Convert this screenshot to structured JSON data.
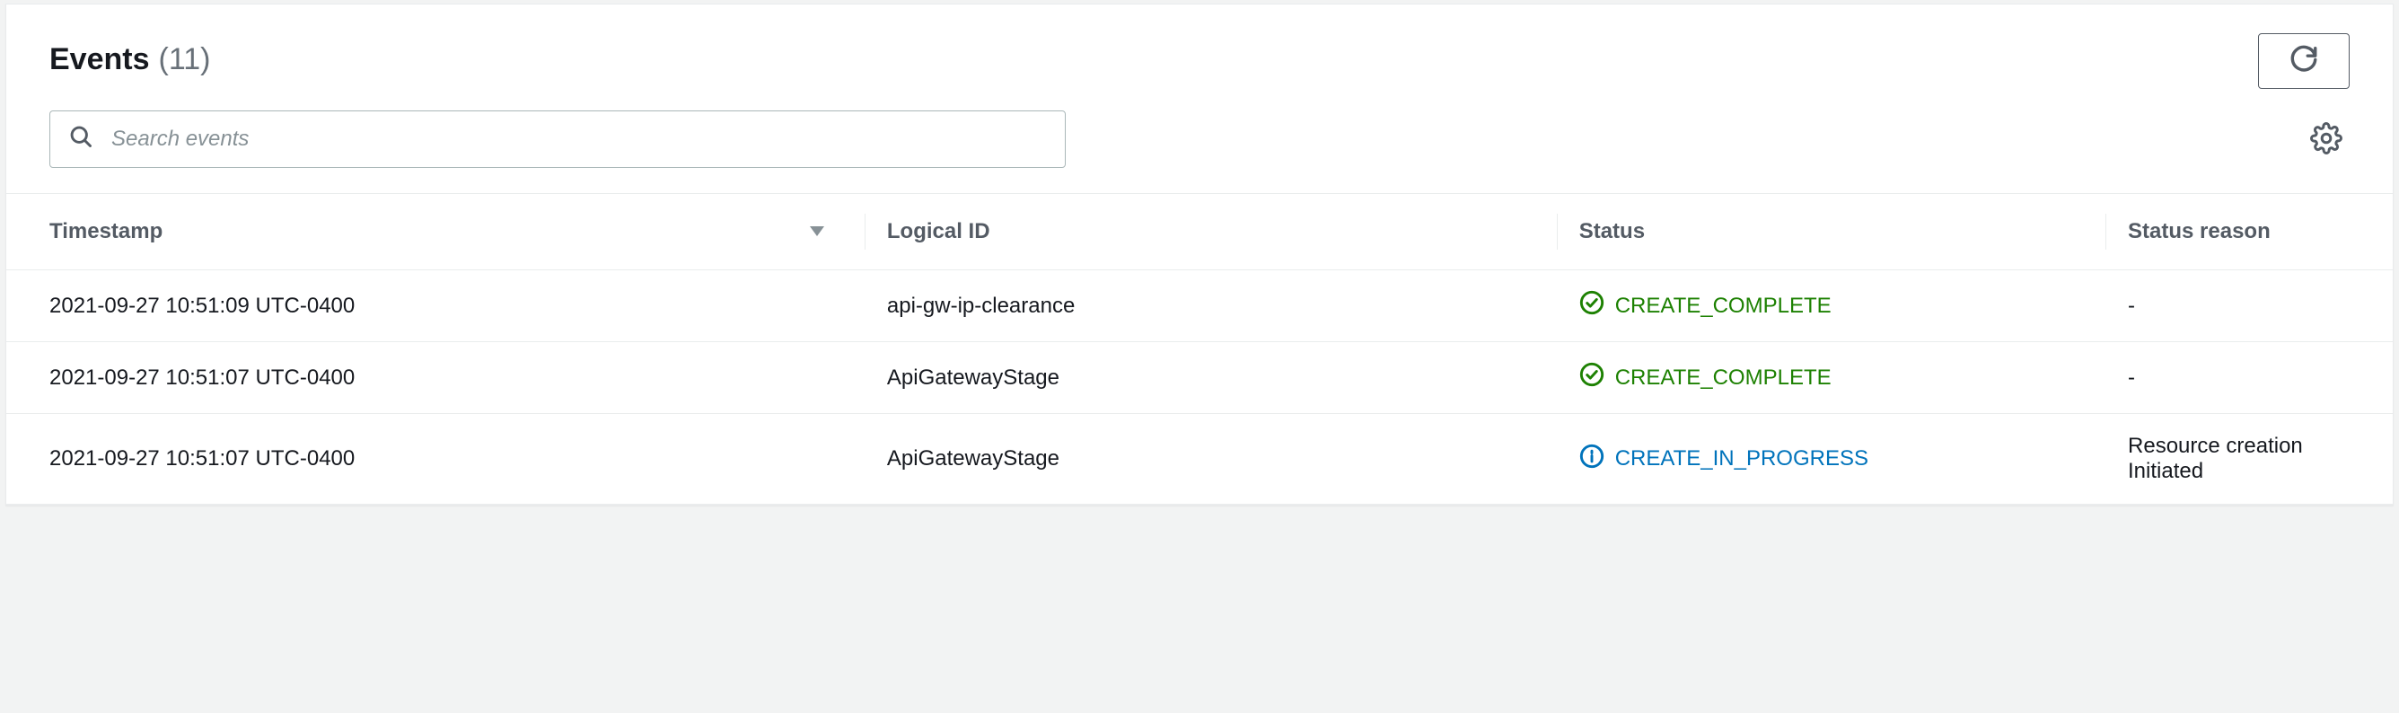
{
  "header": {
    "title": "Events",
    "count_display": "(11)"
  },
  "search": {
    "placeholder": "Search events"
  },
  "columns": {
    "timestamp": "Timestamp",
    "logical_id": "Logical ID",
    "status": "Status",
    "status_reason": "Status reason"
  },
  "rows": [
    {
      "timestamp": "2021-09-27 10:51:09 UTC-0400",
      "logical_id": "api-gw-ip-clearance",
      "status_text": "CREATE_COMPLETE",
      "status_kind": "complete",
      "reason": "-"
    },
    {
      "timestamp": "2021-09-27 10:51:07 UTC-0400",
      "logical_id": "ApiGatewayStage",
      "status_text": "CREATE_COMPLETE",
      "status_kind": "complete",
      "reason": "-"
    },
    {
      "timestamp": "2021-09-27 10:51:07 UTC-0400",
      "logical_id": "ApiGatewayStage",
      "status_text": "CREATE_IN_PROGRESS",
      "status_kind": "progress",
      "reason": "Resource creation Initiated"
    }
  ]
}
